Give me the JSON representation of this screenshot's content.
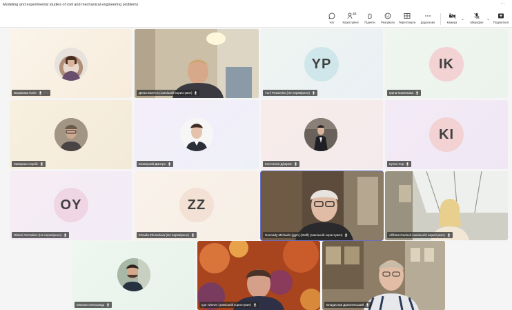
{
  "window": {
    "title": "Modeling and experimental studies of civil and mechanical engineering problems",
    "more_label": "···"
  },
  "toolbar": {
    "chat": "Чат",
    "people": "Користувачі",
    "people_count": "45",
    "raise": "Підняти",
    "react": "Реагувати",
    "view": "Переглянути",
    "more": "Додатково",
    "camera": "Камера",
    "mic": "Мікрофон",
    "share": "Поділитися"
  },
  "participants": [
    {
      "name": "Верамова Юлія",
      "kind": "photo",
      "more": "···"
    },
    {
      "name": "Денис Воечок (зовнішній користувач)",
      "kind": "video"
    },
    {
      "name": "Yurii Protsenko (Не перевірено)",
      "kind": "initials",
      "initials": "YP",
      "color": "#cfe6ea"
    },
    {
      "name": "Ірина Коженкова",
      "kind": "initials",
      "initials": "IK",
      "color": "#f2d2d2"
    },
    {
      "name": "Завярнин Сергій",
      "kind": "photo"
    },
    {
      "name": "Безверхий Дмитро",
      "kind": "photo"
    },
    {
      "name": "Костянтин Дікарев",
      "kind": "photo"
    },
    {
      "name": "Кучин Ігор",
      "kind": "initials",
      "initials": "KI",
      "color": "#f2d2d2"
    },
    {
      "name": "Oleksii Yermakov (Не перевірено)",
      "kind": "initials",
      "initials": "OY",
      "color": "#f0d5e4"
    },
    {
      "name": "Zinaida Zhuravlova (Не перевірено)",
      "kind": "initials",
      "initials": "ZZ",
      "color": "#f2e1d4"
    },
    {
      "name": "Gennady Michaels (ggm) (Staff) (зовнішній користувач)",
      "kind": "video"
    },
    {
      "name": "Alžbeta Gedová (зовнішній користувач)",
      "kind": "video"
    },
    {
      "name": "Мохнан Олександр",
      "kind": "photo"
    },
    {
      "name": "Igor Ivlenev (зовнішній користувач)",
      "kind": "video"
    },
    {
      "name": "Владислав Даниленський",
      "kind": "video"
    }
  ]
}
